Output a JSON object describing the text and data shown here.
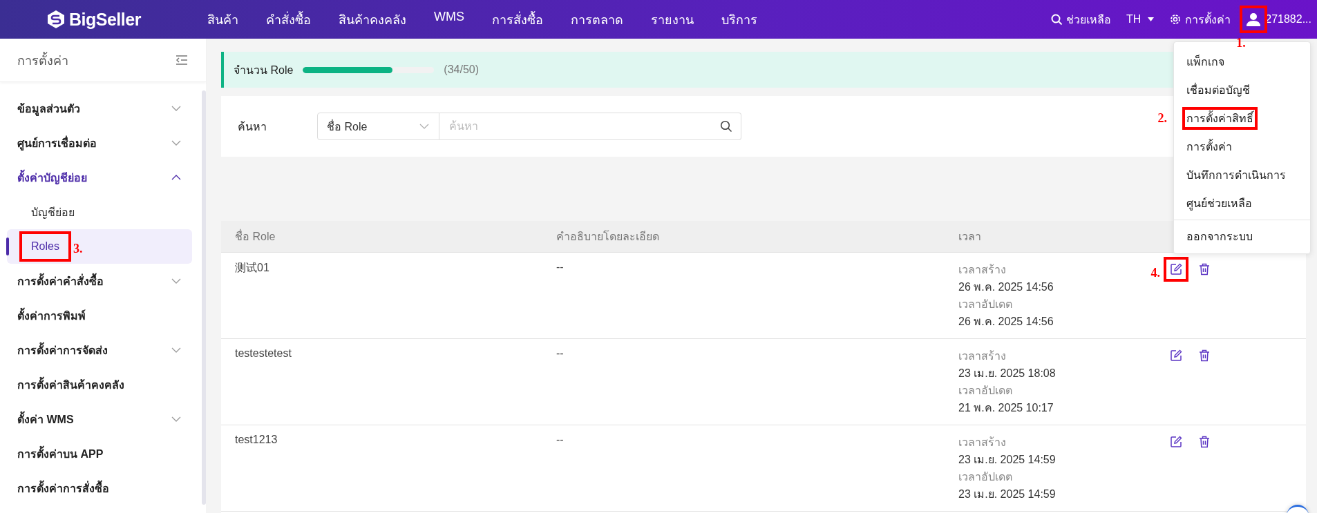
{
  "topbar": {
    "logo": "BigSeller",
    "nav": [
      {
        "label": "สินค้า"
      },
      {
        "label": "คำสั่งซื้อ"
      },
      {
        "label": "สินค้าคงคลัง"
      },
      {
        "label": "WMS"
      },
      {
        "label": "การสั่งซื้อ"
      },
      {
        "label": "การตลาด"
      },
      {
        "label": "รายงาน"
      },
      {
        "label": "บริการ"
      }
    ],
    "help": "ช่วยเหลือ",
    "language": "TH",
    "settings": "การตั้งค่า",
    "user": {
      "name": "271882...",
      "annotation": "1."
    }
  },
  "user_menu": {
    "items": [
      {
        "label": "แพ็กเกจ"
      },
      {
        "label": "เชื่อมต่อบัญชี"
      },
      {
        "label": "การตั้งค่าสิทธิ์",
        "annotation": "2."
      },
      {
        "label": "การตั้งค่า"
      },
      {
        "label": "บันทึกการดำเนินการ"
      },
      {
        "label": "ศูนย์ช่วยเหลือ"
      }
    ],
    "logout": "ออกจากระบบ"
  },
  "sidebar": {
    "title": "การตั้งค่า",
    "items": [
      {
        "label": "ข้อมูลส่วนตัว",
        "kind": "group",
        "expanded": false
      },
      {
        "label": "ศูนย์การเชื่อมต่อ",
        "kind": "group",
        "expanded": false
      },
      {
        "label": "ตั้งค่าบัญชีย่อย",
        "kind": "group",
        "expanded": true,
        "children": [
          {
            "label": "บัญชีย่อย",
            "selected": false
          },
          {
            "label": "Roles",
            "selected": true,
            "annotation": "3."
          }
        ]
      },
      {
        "label": "การตั้งค่าคำสั่งซื้อ",
        "kind": "group",
        "expanded": false
      },
      {
        "label": "ตั้งค่าการพิมพ์",
        "kind": "link"
      },
      {
        "label": "การตั้งค่าการจัดส่ง",
        "kind": "group",
        "expanded": false
      },
      {
        "label": "การตั้งค่าสินค้าคงคลัง",
        "kind": "link"
      },
      {
        "label": "ตั้งค่า WMS",
        "kind": "group",
        "expanded": false
      },
      {
        "label": "การตั้งค่าบน APP",
        "kind": "link"
      },
      {
        "label": "การตั้งค่าการสั่งซื้อ",
        "kind": "link"
      }
    ]
  },
  "quota": {
    "label": "จำนวน Role",
    "level": 0.68,
    "count": "(34/50)"
  },
  "search": {
    "label": "ค้นหา",
    "field": "ชื่อ Role",
    "placeholder": "ค้นหา"
  },
  "table": {
    "columns": [
      "ชื่อ Role",
      "คำอธิบายโดยละเอียด",
      "เวลา"
    ],
    "rows": [
      {
        "name": "测试01",
        "description": "--",
        "created_label": "เวลาสร้าง",
        "created": "26 พ.ค. 2025 14:56",
        "updated_label": "เวลาอัปเดต",
        "updated": "26 พ.ค. 2025 14:56",
        "annotation": "4."
      },
      {
        "name": "testestetest",
        "description": "--",
        "created_label": "เวลาสร้าง",
        "created": "23 เม.ย. 2025 18:08",
        "updated_label": "เวลาอัปเดต",
        "updated": "21 พ.ค. 2025 10:17"
      },
      {
        "name": "test1213",
        "description": "--",
        "created_label": "เวลาสร้าง",
        "created": "23 เม.ย. 2025 14:59",
        "updated_label": "เวลาอัปเดต",
        "updated": "23 เม.ย. 2025 14:59"
      }
    ]
  }
}
